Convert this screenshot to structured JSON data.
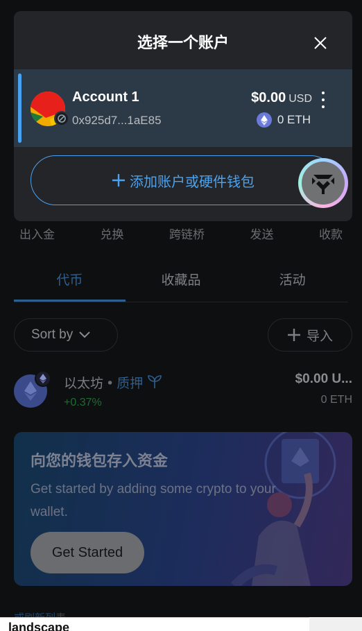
{
  "modal": {
    "title": "选择一个账户",
    "account": {
      "name": "Account 1",
      "address": "0x925d7...1aE85",
      "fiat_value": "$0.00",
      "fiat_currency": "USD",
      "eth_balance": "0 ETH",
      "selected": true
    },
    "add_button_label": "添加账户或硬件钱包"
  },
  "actions": [
    "出入金",
    "兑换",
    "跨链桥",
    "发送",
    "收款"
  ],
  "tabs": [
    {
      "label": "代币",
      "active": true
    },
    {
      "label": "收藏品",
      "active": false
    },
    {
      "label": "活动",
      "active": false
    }
  ],
  "toolbar": {
    "sort_label": "Sort by",
    "import_label": "导入"
  },
  "token": {
    "name": "以太坊",
    "separator": "•",
    "stake_label": "质押",
    "change": "+0.37%",
    "fiat_value": "$0.00 U...",
    "amount": "0 ETH"
  },
  "promo": {
    "title": "向您的钱包存入资金",
    "text": "Get started by adding some crypto to your wallet.",
    "button_label": "Get Started"
  },
  "footer": {
    "refresh_link": "或刷新列表",
    "bottom_bar_text": "landscape"
  },
  "colors": {
    "accent": "#4aa3f0",
    "modal_bg": "#232528",
    "selected_account_bg": "#2b3a46",
    "positive_change": "#1f6b35"
  },
  "icons": {
    "close": "close-icon",
    "kebab": "more-vertical-icon",
    "eth": "eth-icon",
    "plus": "plus-icon",
    "chevron": "chevron-down-icon",
    "stake_leaf": "sprout-icon",
    "floating": "app-logo-icon"
  }
}
